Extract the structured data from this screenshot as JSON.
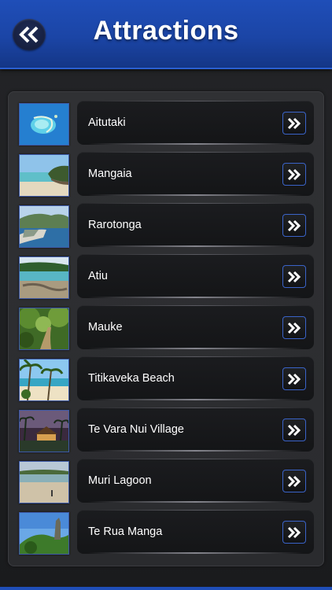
{
  "header": {
    "title": "Attractions",
    "back_icon": "double-chevron-left-icon"
  },
  "colors": {
    "header_blue": "#1f4eb8",
    "panel": "#2d2e31",
    "button_border": "#3a63c8"
  },
  "attractions": [
    {
      "name": "Aitutaki",
      "icon": "double-chevron-right-icon"
    },
    {
      "name": "Mangaia",
      "icon": "double-chevron-right-icon"
    },
    {
      "name": "Rarotonga",
      "icon": "double-chevron-right-icon"
    },
    {
      "name": "Atiu",
      "icon": "double-chevron-right-icon"
    },
    {
      "name": "Mauke",
      "icon": "double-chevron-right-icon"
    },
    {
      "name": "Titikaveka Beach",
      "icon": "double-chevron-right-icon"
    },
    {
      "name": "Te Vara Nui Village",
      "icon": "double-chevron-right-icon"
    },
    {
      "name": "Muri Lagoon",
      "icon": "double-chevron-right-icon"
    },
    {
      "name": "Te Rua Manga",
      "icon": "double-chevron-right-icon"
    }
  ]
}
